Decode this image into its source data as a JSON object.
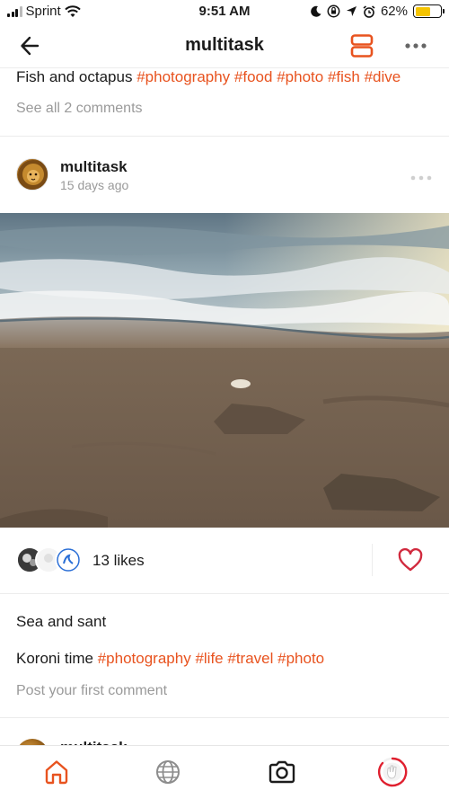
{
  "status_bar": {
    "carrier": "Sprint",
    "time": "9:51 AM",
    "battery_percent": "62%",
    "battery_level": 0.62,
    "icons": [
      "signal-bars-icon",
      "wifi-icon",
      "moon-icon",
      "orientation-lock-icon",
      "location-arrow-icon",
      "alarm-icon",
      "battery-icon"
    ]
  },
  "header": {
    "title": "multitask",
    "back_icon": "arrow-left-icon",
    "layout_icon": "stacked-layout-icon",
    "more_icon": "more-dots-icon"
  },
  "previous_post": {
    "caption_text": "Fish and octapus",
    "hashtags": [
      "#photography",
      "#food",
      "#photo",
      "#fish",
      "#dive"
    ],
    "see_comments": "See all 2 comments"
  },
  "post": {
    "username": "multitask",
    "time_ago": "15 days ago",
    "photo_subject": "beach-shoreline-photo",
    "likes": "13 likes",
    "caption_title": "Sea and sant",
    "caption_text": "Koroni time",
    "hashtags": [
      "#photography",
      "#life",
      "#travel",
      "#photo"
    ],
    "comment_prompt": "Post your first comment"
  },
  "next_post": {
    "username": "multitask"
  },
  "tabbar": {
    "tabs": [
      {
        "name": "home-icon",
        "active": true
      },
      {
        "name": "globe-icon",
        "active": false
      },
      {
        "name": "camera-icon",
        "active": false
      },
      {
        "name": "profile-ring-icon",
        "active": false
      }
    ]
  },
  "colors": {
    "accent": "#e8531f",
    "muted_text": "#9a9a9a",
    "heart": "#d12a3e",
    "battery_fill": "#f5c400"
  }
}
